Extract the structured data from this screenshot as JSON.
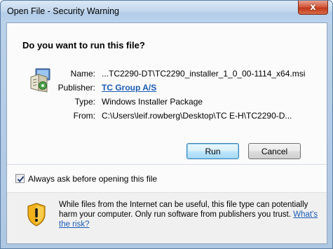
{
  "window": {
    "title": "Open File - Security Warning",
    "close_glyph": "x"
  },
  "question": "Do you want to run this file?",
  "file_info": [
    {
      "label": "Name:",
      "value": "...TC2290-DT\\TC2290_installer_1_0_00-1114_x64.msi",
      "is_link": false
    },
    {
      "label": "Publisher:",
      "value": "TC Group A/S",
      "is_link": true
    },
    {
      "label": "Type:",
      "value": "Windows Installer Package",
      "is_link": false
    },
    {
      "label": "From:",
      "value": "C:\\Users\\leif.rowberg\\Desktop\\TC E-H\\TC2290-D...",
      "is_link": false
    }
  ],
  "buttons": {
    "run": "Run",
    "cancel": "Cancel"
  },
  "checkbox": {
    "label": "Always ask before opening this file",
    "checked": true
  },
  "warning": {
    "text": "While files from the Internet can be useful, this file type can potentially harm your computer. Only run software from publishers you trust.",
    "link": "What's the risk?"
  },
  "icons": {
    "file": "installer-package-icon",
    "warning": "security-shield-icon",
    "check": "checkmark-icon"
  },
  "colors": {
    "link": "#1a5bb5",
    "close_button": "#c0391c",
    "title_bar": "#c4d8ee"
  }
}
